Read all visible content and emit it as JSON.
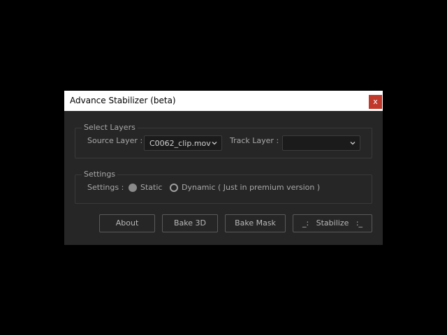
{
  "window": {
    "title": "Advance Stabilizer (beta)",
    "close_glyph": "x"
  },
  "select_layers": {
    "group_title": "Select Layers",
    "source_label": "Source Layer :",
    "source_value": "C0062_clip.mov",
    "track_label": "Track Layer :",
    "track_value": ""
  },
  "settings": {
    "group_title": "Settings",
    "label": "Settings :",
    "options": [
      {
        "label": "Static",
        "selected": true
      },
      {
        "label": "Dynamic ( Just in premium version )",
        "selected": false
      }
    ]
  },
  "buttons": {
    "about": "About",
    "bake_3d": "Bake 3D",
    "bake_mask": "Bake Mask",
    "stabilize": "_:   Stabilize   :_"
  },
  "colors": {
    "dialog_bg": "#262626",
    "close_button": "#c0392b",
    "text": "#a8a8a8"
  }
}
